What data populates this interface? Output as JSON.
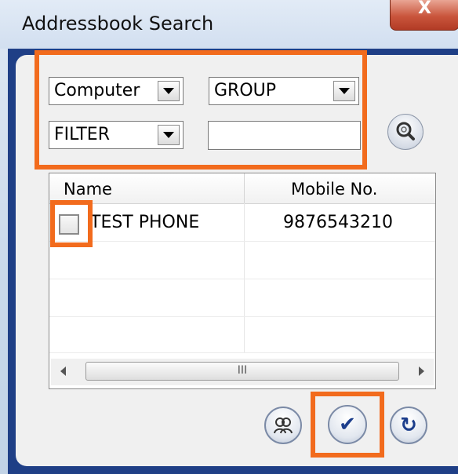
{
  "window": {
    "title": "Addressbook Search",
    "close_label": "X"
  },
  "filters": {
    "source_value": "Computer",
    "group_value": "GROUP",
    "filter_value": "FILTER",
    "search_text": ""
  },
  "table": {
    "columns": [
      "Name",
      "Mobile No."
    ],
    "rows": [
      {
        "name": "TEST PHONE",
        "mobile": "9876543210",
        "checked": false
      }
    ],
    "scroll_grip": "III"
  },
  "buttons": {
    "search_icon": "magnifier-icon",
    "contacts_icon": "contacts-icon",
    "ok_glyph": "✔",
    "refresh_glyph": "↻"
  },
  "colors": {
    "highlight": "#f26b1d",
    "frame": "#1f3f86"
  }
}
